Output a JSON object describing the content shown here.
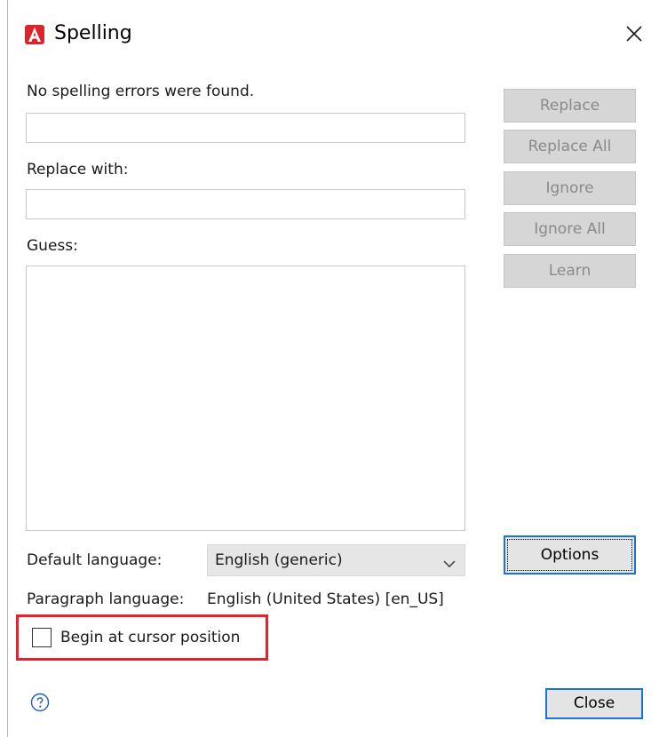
{
  "window": {
    "title": "Spelling",
    "app_icon": "acrobat-a-icon",
    "close_icon": "close-icon"
  },
  "status": {
    "message": "No spelling errors were found."
  },
  "not_in_dictionary": {
    "value": ""
  },
  "replace_with": {
    "label": "Replace with:",
    "value": ""
  },
  "guess": {
    "label": "Guess:",
    "items": []
  },
  "side_buttons": {
    "replace": "Replace",
    "replace_all": "Replace All",
    "ignore": "Ignore",
    "ignore_all": "Ignore All",
    "learn": "Learn"
  },
  "default_language": {
    "label": "Default language:",
    "selected": "English (generic)"
  },
  "paragraph_language": {
    "label": "Paragraph language:",
    "value": "English (United States) [en_US]"
  },
  "begin_at_cursor": {
    "label": "Begin at cursor position",
    "checked": false
  },
  "footer": {
    "help_icon": "help-icon",
    "options_label": "Options",
    "close_label": "Close"
  },
  "colors": {
    "highlight": "#e8202a",
    "focus_border": "#1a73d9",
    "disabled_button": "#d6d6d6",
    "app_icon_red": "#d9262c"
  }
}
